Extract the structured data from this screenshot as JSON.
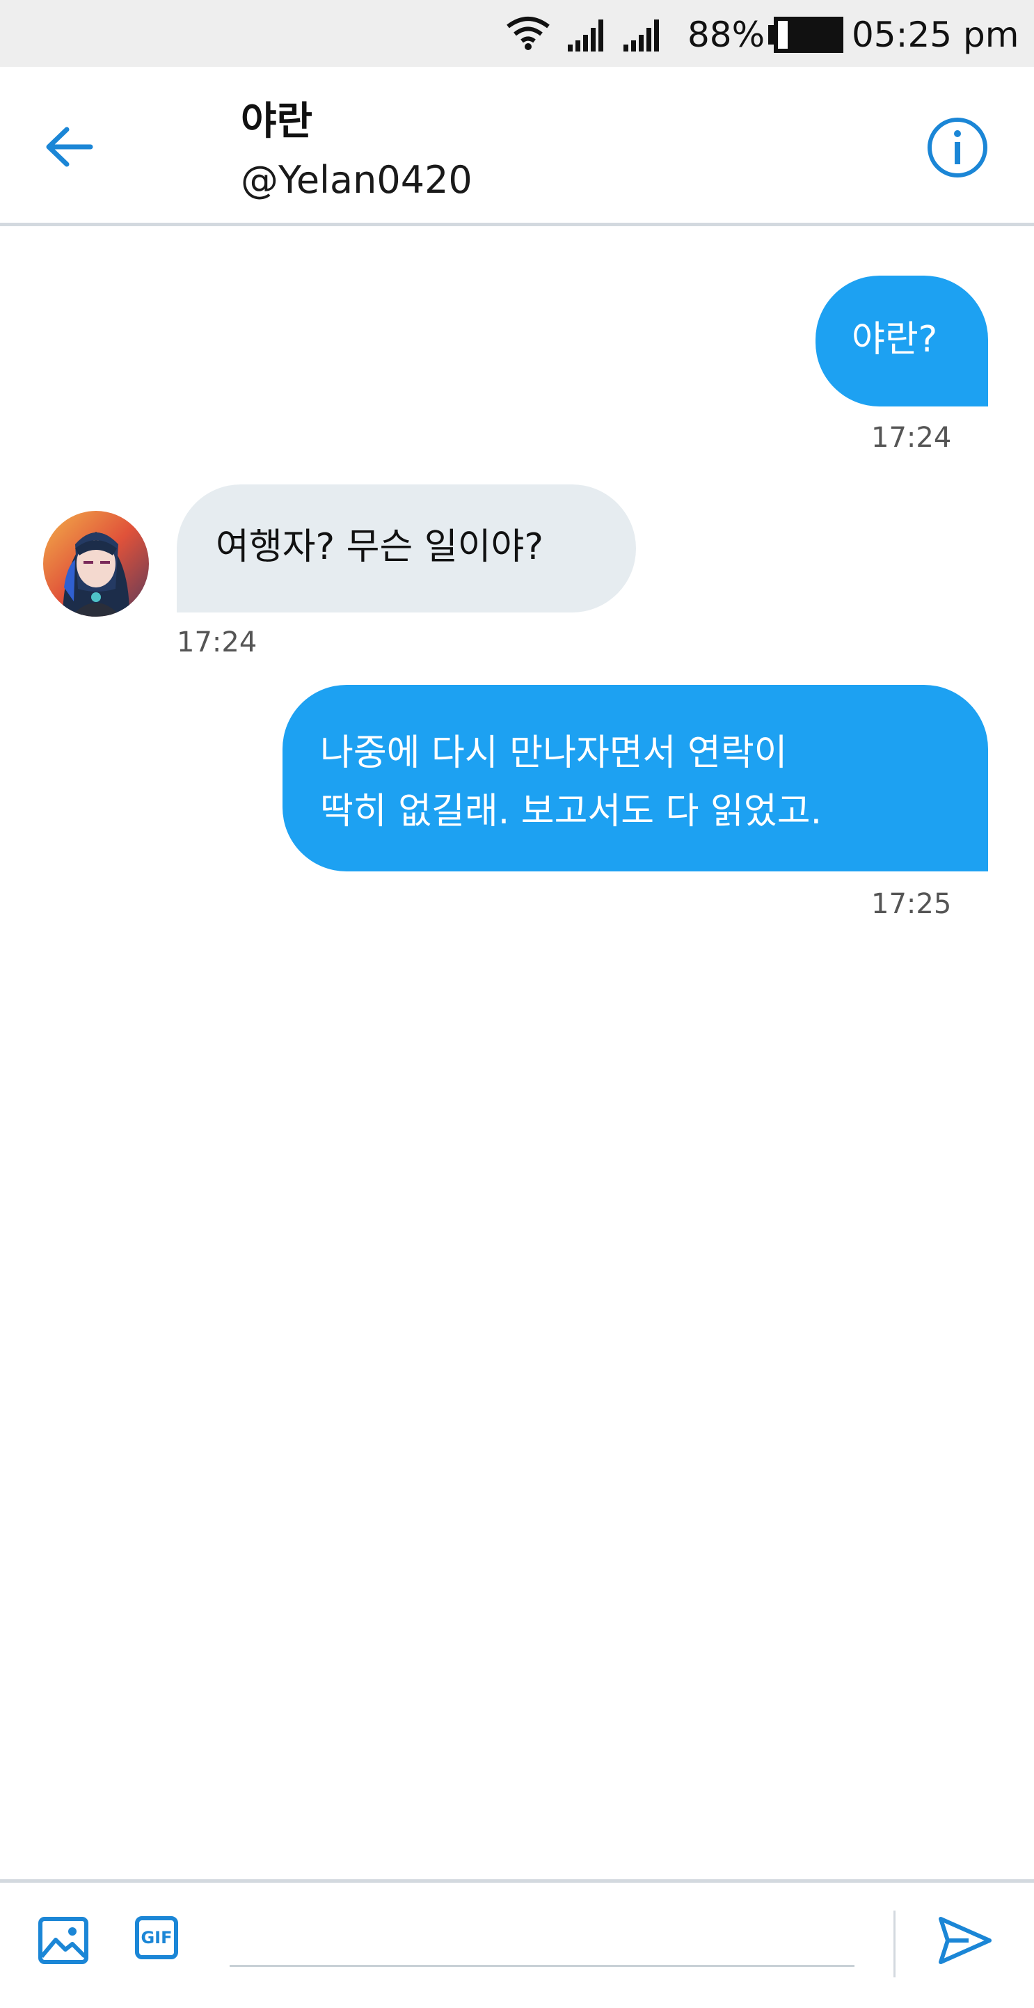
{
  "status_bar": {
    "battery_percent": "88%",
    "time": "05:25 pm",
    "icons": [
      "wifi-icon",
      "signal-icon",
      "signal-icon",
      "battery-icon"
    ]
  },
  "header": {
    "title": "야란",
    "handle": "@Yelan0420",
    "icons": [
      "back-arrow-icon",
      "info-icon"
    ]
  },
  "messages": [
    {
      "direction": "outgoing",
      "text_lines": [
        "야란?"
      ],
      "time": "17:24"
    },
    {
      "direction": "incoming",
      "text_lines": [
        "여행자? 무슨 일이야?"
      ],
      "time": "17:24",
      "avatar": "avatar-yelan"
    },
    {
      "direction": "outgoing",
      "text_lines": [
        "나중에 다시 만나자면서 연락이",
        "딱히 없길래. 보고서도 다 읽었고."
      ],
      "time": "17:25"
    }
  ],
  "composer": {
    "placeholder": "",
    "icons": [
      "image-icon",
      "gif-icon",
      "send-icon"
    ],
    "gif_label": "GIF"
  },
  "colors": {
    "accent": "#1da1f2",
    "icon_blue": "#1b86d6",
    "incoming_bubble": "#e6ecf0",
    "statusbar_bg": "#eeeeee",
    "divider": "#d3d9df"
  }
}
